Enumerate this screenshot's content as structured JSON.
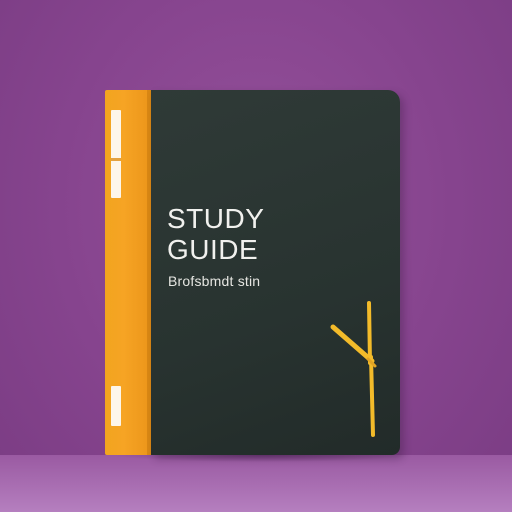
{
  "book": {
    "title_line1": "STUDY",
    "title_line2": "GUIDE",
    "subtitle": "Brofsbmdt stin"
  },
  "colors": {
    "background": "#86448e",
    "cover": "#2b3532",
    "spine": "#f4a422",
    "clock_hands": "#f3bb2a",
    "title_text": "#f1f1ee"
  },
  "icons": [
    "clock-icon",
    "bookmark-tab-icon"
  ]
}
